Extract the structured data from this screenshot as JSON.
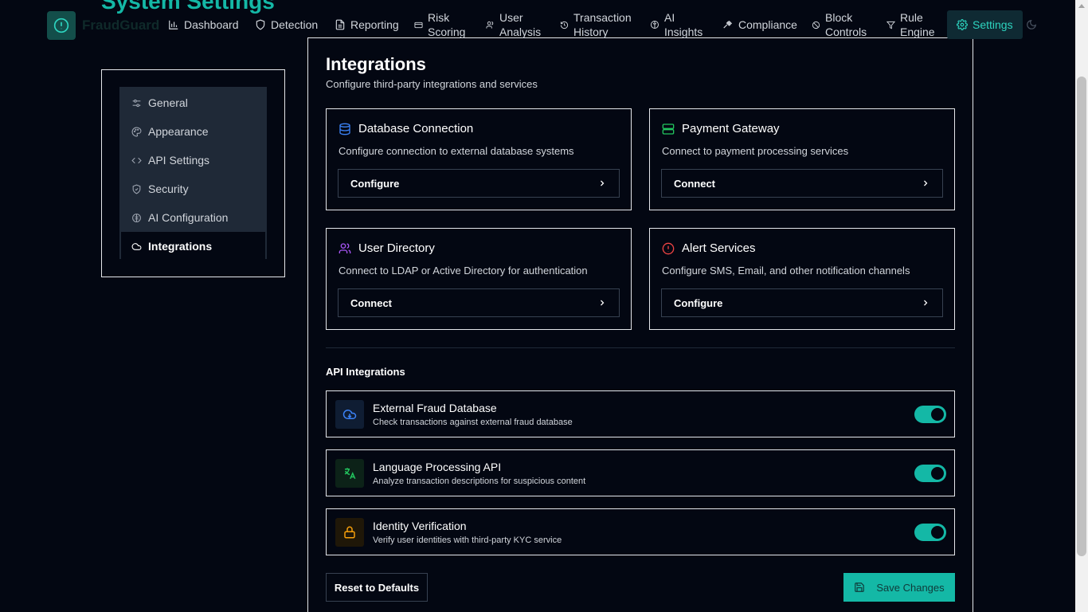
{
  "app": {
    "page_title": "System Settings",
    "brand": "FraudGuard",
    "brand_color": "#14b8a6",
    "logo_icon": "alert-circle-icon"
  },
  "nav": {
    "items": [
      {
        "label": "Dashboard",
        "icon": "bar-chart-icon"
      },
      {
        "label": "Detection",
        "icon": "shield-icon"
      },
      {
        "label": "Reporting",
        "icon": "file-text-icon"
      },
      {
        "label": "Risk Scoring",
        "icon": "credit-card-icon"
      },
      {
        "label": "User Analysis",
        "icon": "users-icon"
      },
      {
        "label": "Transaction History",
        "icon": "history-icon"
      },
      {
        "label": "AI Insights",
        "icon": "brain-icon"
      },
      {
        "label": "Compliance",
        "icon": "gavel-icon"
      },
      {
        "label": "Block Controls",
        "icon": "ban-icon"
      },
      {
        "label": "Rule Engine",
        "icon": "filter-icon"
      },
      {
        "label": "Settings",
        "icon": "gear-icon",
        "active": true
      }
    ],
    "theme_toggle_icon": "moon-icon"
  },
  "sidebar": {
    "items": [
      {
        "label": "General",
        "icon": "sliders-icon"
      },
      {
        "label": "Appearance",
        "icon": "palette-icon"
      },
      {
        "label": "API Settings",
        "icon": "code-icon"
      },
      {
        "label": "Security",
        "icon": "shield-check-icon"
      },
      {
        "label": "AI Configuration",
        "icon": "brain-icon"
      },
      {
        "label": "Integrations",
        "icon": "cloud-icon",
        "active": true
      }
    ]
  },
  "main": {
    "title": "Integrations",
    "subtitle": "Configure third-party integrations and services",
    "cards": [
      {
        "title": "Database Connection",
        "description": "Configure connection to external database systems",
        "button": "Configure",
        "icon": "database-icon",
        "color": "#3b82f6"
      },
      {
        "title": "Payment Gateway",
        "description": "Connect to payment processing services",
        "button": "Connect",
        "icon": "server-icon",
        "color": "#22c55e"
      },
      {
        "title": "User Directory",
        "description": "Connect to LDAP or Active Directory for authentication",
        "button": "Connect",
        "icon": "users-icon",
        "color": "#a855f7"
      },
      {
        "title": "Alert Services",
        "description": "Configure SMS, Email, and other notification channels",
        "button": "Configure",
        "icon": "alert-circle-icon",
        "color": "#ef4444"
      }
    ],
    "api_heading": "API Integrations",
    "api_items": [
      {
        "name": "External Fraud Database",
        "description": "Check transactions against external fraud database",
        "enabled": true,
        "icon": "cloud-download-icon",
        "color": "#3b82f6"
      },
      {
        "name": "Language Processing API",
        "description": "Analyze transaction descriptions for suspicious content",
        "enabled": true,
        "icon": "languages-icon",
        "color": "#22c55e"
      },
      {
        "name": "Identity Verification",
        "description": "Verify user identities with third-party KYC service",
        "enabled": true,
        "icon": "lock-icon",
        "color": "#f59e0b"
      }
    ],
    "reset_label": "Reset to Defaults",
    "save_label": "Save Changes"
  }
}
